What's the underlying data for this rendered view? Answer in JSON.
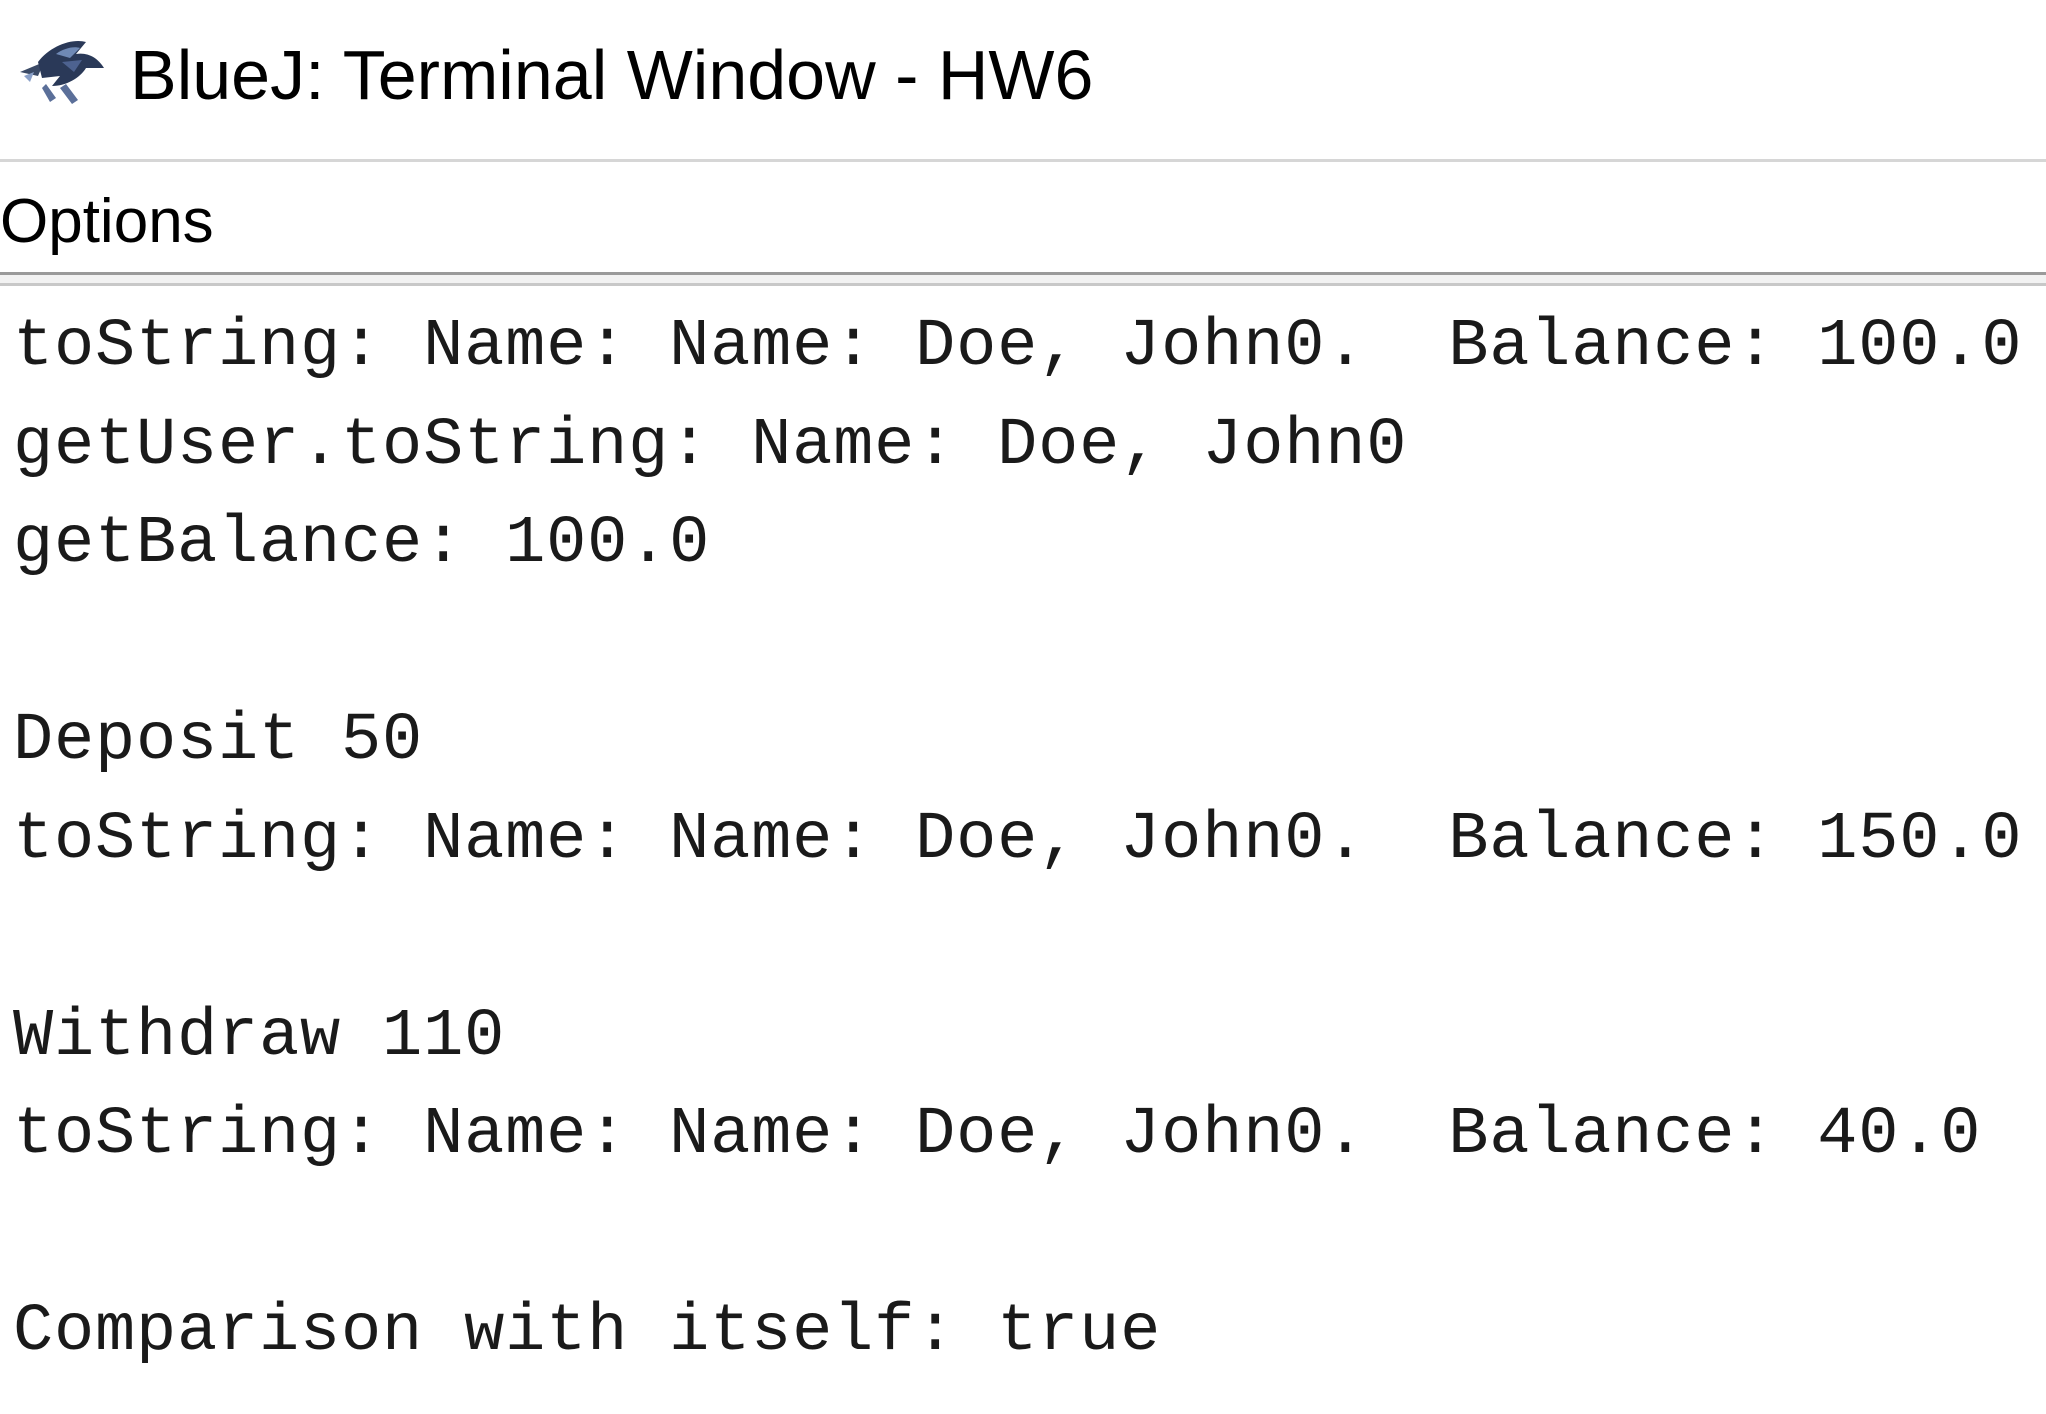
{
  "window": {
    "title": "BlueJ: Terminal Window - HW6",
    "icon": "bluej-bird-icon"
  },
  "menubar": {
    "items": [
      {
        "label": "Options"
      }
    ]
  },
  "terminal": {
    "lines": [
      "toString: Name: Name: Doe, John0.  Balance: 100.0",
      "getUser.toString: Name: Doe, John0",
      "getBalance: 100.0",
      "",
      "Deposit 50",
      "toString: Name: Name: Doe, John0.  Balance: 150.0",
      "",
      "Withdraw 110",
      "toString: Name: Name: Doe, John0.  Balance: 40.0",
      "",
      "Comparison with itself: true"
    ]
  }
}
